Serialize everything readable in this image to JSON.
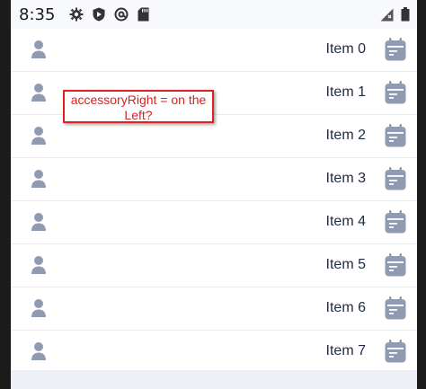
{
  "status_bar": {
    "time": "8:35",
    "icons": [
      "gear-icon",
      "shield-icon",
      "at-icon",
      "sd-card-icon"
    ],
    "right_icons": [
      "signal-icon",
      "battery-icon"
    ]
  },
  "list": {
    "items": [
      {
        "label": "Item 0"
      },
      {
        "label": "Item 1"
      },
      {
        "label": "Item 2"
      },
      {
        "label": "Item 3"
      },
      {
        "label": "Item 4"
      },
      {
        "label": "Item 5"
      },
      {
        "label": "Item 6"
      },
      {
        "label": "Item 7"
      }
    ],
    "accessory_left_icon": "person-icon",
    "accessory_right_icon": "calendar-icon",
    "icon_color": "#8f9bb3",
    "text_color": "#222b45"
  },
  "annotation": {
    "text": "accessoryRight = on the Left?",
    "color": "#e01e1e"
  }
}
